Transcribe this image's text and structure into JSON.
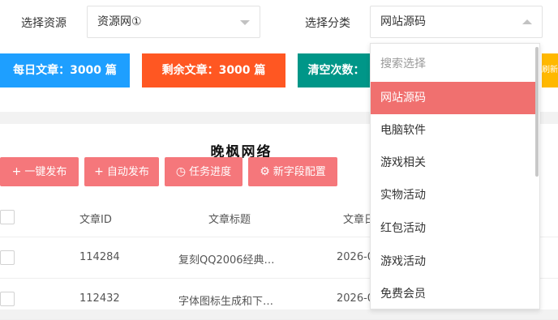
{
  "filters": {
    "source_label": "选择资源",
    "source_value": "资源网①",
    "category_label": "选择分类",
    "category_value": "网站源码"
  },
  "stats": {
    "daily": "每日文章：3000 篇",
    "remaining": "剩余文章：3000 篇",
    "clear": "清空次数：",
    "edge": "刷新"
  },
  "brand": "晚枫网络",
  "toolbar": {
    "one_click_publish": "一键发布",
    "auto_publish": "自动发布",
    "task_progress": "任务进度",
    "new_field_config": "新字段配置"
  },
  "table": {
    "headers": {
      "id": "文章ID",
      "title": "文章标题",
      "date": "文章日"
    },
    "rows": [
      {
        "id": "114284",
        "title": "复刻QQ2006经典…",
        "date": "2026-0"
      },
      {
        "id": "112432",
        "title": "字体图标生成和下…",
        "date": "2026-0"
      }
    ]
  },
  "dropdown": {
    "search_placeholder": "搜索选择",
    "options": [
      "网站源码",
      "电脑软件",
      "游戏相关",
      "实物活动",
      "红包活动",
      "游戏活动",
      "免费会员"
    ],
    "selected": "网站源码"
  },
  "colors": {
    "blue": "#1e9fff",
    "orange": "#ff5722",
    "teal": "#009688",
    "pink_button": "#f5777b",
    "selected_option": "#f0706f",
    "yellow": "#ffb800"
  },
  "icons": [
    "plus-icon",
    "clock-icon",
    "gear-icon",
    "chevron-down-icon",
    "chevron-up-icon"
  ]
}
